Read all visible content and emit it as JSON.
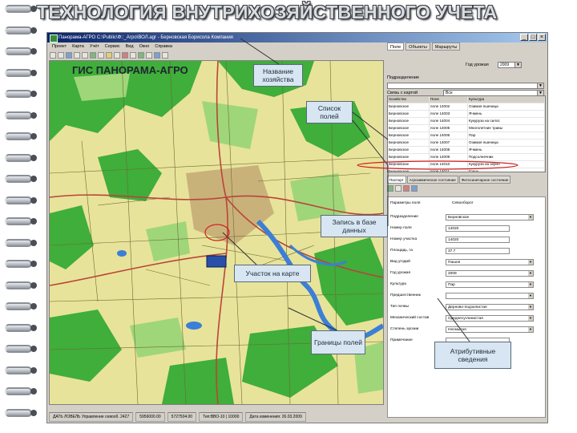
{
  "slide": {
    "title": "ТЕХНОЛОГИЯ ВНУТРИХОЗЯЙСТВЕННОГО УЧЕТА"
  },
  "app": {
    "title": "Панорама-АГРО C:\\Public\\Ф::_Агро\\ВОЛ.agr - Берновская Борисола Компания",
    "menu": [
      "Проект",
      "Карта",
      "Учёт",
      "Сервис",
      "Вид",
      "Окно",
      "Справка"
    ],
    "map_label": "ГИС ПАНОРАМА-АГРО",
    "status": [
      "ДАТЬ ЛОВЕЛЬ Управление севооб. 2427",
      "5956000.00",
      "5727504.00",
      "Тип:ВВО-10 | 10000"
    ]
  },
  "panel": {
    "top_tabs": [
      "Поле",
      "Объекты",
      "Маршруты"
    ],
    "year_label": "Год урожая",
    "year_value": "2009",
    "subdivision_label": "Подразделение",
    "link_label": "Связь с картой",
    "link_value": "Все",
    "list_header": [
      "Хозяйство",
      "Поле",
      "Культура"
    ],
    "rows": [
      {
        "farm": "Берновское",
        "field": "поле 14002",
        "crop": "Озимая пшеница"
      },
      {
        "farm": "Берновское",
        "field": "поле 14003",
        "crop": "Ячмень"
      },
      {
        "farm": "Берновское",
        "field": "поле 14004",
        "crop": "Кукуруза на силос"
      },
      {
        "farm": "Берновское",
        "field": "поле 14005",
        "crop": "Многолетние травы"
      },
      {
        "farm": "Берновское",
        "field": "поле 14006",
        "crop": "Пар"
      },
      {
        "farm": "Берновское",
        "field": "поле 14007",
        "crop": "Озимая пшеница"
      },
      {
        "farm": "Берновское",
        "field": "поле 14008",
        "crop": "Ячмень"
      },
      {
        "farm": "Берновское",
        "field": "поле 14009",
        "crop": "Подсолнечник"
      },
      {
        "farm": "Берновское",
        "field": "поле 14010",
        "crop": "Кукуруза на зерно"
      },
      {
        "farm": "Берновское",
        "field": "поле 14011",
        "crop": "Горох"
      },
      {
        "farm": "Берновское",
        "field": "поле 14012",
        "crop": "Пар"
      }
    ],
    "sub_tabs": [
      "Паспорт",
      "Агрохимическое состояние",
      "Фитосанитарное состояние"
    ],
    "params_tabs": [
      "Параметры поля",
      "Севооборот"
    ],
    "form": [
      {
        "label": "Подразделение",
        "value": "Берновское",
        "dd": true
      },
      {
        "label": "Номер поля",
        "value": "14020",
        "dd": false
      },
      {
        "label": "Номер участка",
        "value": "14020",
        "dd": false
      },
      {
        "label": "Площадь, га",
        "value": "37.7",
        "dd": false
      },
      {
        "label": "Вид угодий",
        "value": "Пашня",
        "dd": true
      },
      {
        "label": "Год урожая",
        "value": "2009",
        "dd": true
      },
      {
        "label": "Культура",
        "value": "Пар",
        "dd": true
      },
      {
        "label": "Предшественник",
        "value": "",
        "dd": true
      },
      {
        "label": "Тип почвы",
        "value": "Дерново-подзолистая",
        "dd": true
      },
      {
        "label": "Механический состав",
        "value": "Среднесуглинистая",
        "dd": true
      },
      {
        "label": "Степень эрозии",
        "value": "Несмытая",
        "dd": true
      },
      {
        "label": "Примечание",
        "value": "",
        "dd": false
      }
    ],
    "date_status": "Дата изменения: 26.03.2009"
  },
  "callouts": {
    "farm_name": "Название хозяйства",
    "fields_list": "Список полей",
    "db_record": "Запись в базе данных",
    "map_plot": "Участок на карте",
    "boundaries": "Границы полей",
    "attributes": "Атрибутивные сведения"
  },
  "colors": {
    "map_field": "#e8e39a",
    "forest": "#3fae3a",
    "meadow": "#9fd67a",
    "water": "#3b7fd6",
    "road": "#b8453a",
    "callout_bg": "#d7e6f2",
    "title_bar": "#0a246a"
  }
}
